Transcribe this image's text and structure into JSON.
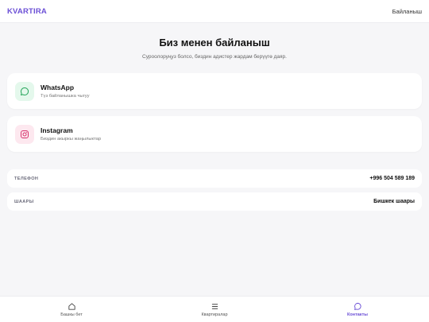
{
  "header": {
    "logo": "KVARTIRA",
    "contact_link": "Байланыш"
  },
  "hero": {
    "title": "Биз менен байланыш",
    "subtitle": "Суроолоруңуз болсо, биздин адистер жардам берүүгө даяр."
  },
  "channels": [
    {
      "icon": "whatsapp-icon",
      "title": "WhatsApp",
      "subtitle": "Түз байланышка чыгуу"
    },
    {
      "icon": "instagram-icon",
      "title": "Instagram",
      "subtitle": "Биздин акыркы жаңылыктар"
    }
  ],
  "info": [
    {
      "label": "ТЕЛЕФОН",
      "value": "+996 504 589 189"
    },
    {
      "label": "ШААРЫ",
      "value": "Бишкек шаары"
    }
  ],
  "nav": [
    {
      "icon": "home-icon",
      "label": "Башкы бет"
    },
    {
      "icon": "list-icon",
      "label": "Квартиралар"
    },
    {
      "icon": "chat-icon",
      "label": "Контакты"
    }
  ],
  "colors": {
    "accent": "#6b4fd6",
    "whatsapp": "#25a55a",
    "instagram": "#d6336c"
  }
}
